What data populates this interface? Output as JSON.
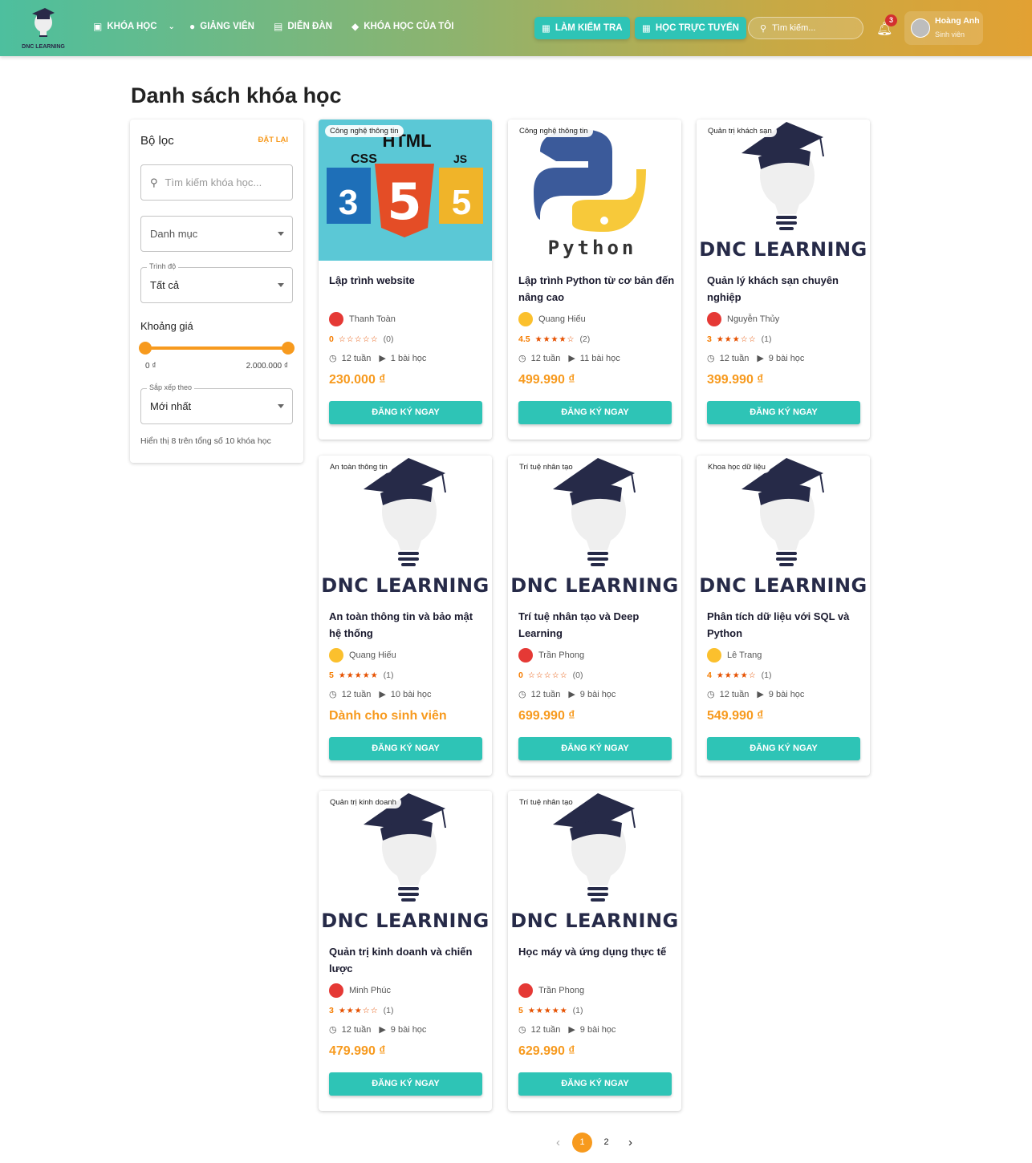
{
  "header": {
    "logo_text": "DNC LEARNING",
    "nav": [
      {
        "label": "KHÓA HỌC",
        "icon": "book-icon",
        "dropdown": true
      },
      {
        "label": "GIẢNG VIÊN",
        "icon": "person-icon"
      },
      {
        "label": "DIỄN ĐÀN",
        "icon": "forum-icon"
      },
      {
        "label": "KHÓA HỌC CỦA TÔI",
        "icon": "school-icon"
      }
    ],
    "quiz_button": "LÀM KIỂM TRA",
    "online_button": "HỌC TRỰC TUYẾN",
    "search_placeholder": "Tìm kiếm...",
    "notification_count": "3",
    "user_name": "Hoàng Anh",
    "user_role": "Sinh viên"
  },
  "page_title": "Danh sách khóa học",
  "filter": {
    "title": "Bộ lọc",
    "reset": "ĐẶT LẠI",
    "search_placeholder": "Tìm kiếm khóa học...",
    "category_placeholder": "Danh mục",
    "level_label": "Trình độ",
    "level_value": "Tất cả",
    "price_label": "Khoảng giá",
    "price_min": "0 ₫",
    "price_max": "2.000.000 ₫",
    "sort_label": "Sắp xếp theo",
    "sort_value": "Mới nhất",
    "summary": "Hiển thị 8 trên tổng số 10 khóa học"
  },
  "image_text": "DNC LEARNING",
  "courses": [
    {
      "category": "Công nghệ thông tin",
      "image": "html",
      "title": "Lập trình website",
      "author": "Thanh Toàn",
      "avatar_color": "#e53935",
      "rating": "0",
      "stars": "☆☆☆☆☆",
      "reviews": "(0)",
      "duration": "12 tuần",
      "lessons": "1 bài học",
      "price": "230.000 ₫"
    },
    {
      "category": "Công nghệ thông tin",
      "image": "python",
      "title": "Lập trình Python từ cơ bản đến nâng cao",
      "author": "Quang Hiếu",
      "avatar_color": "#fbc02d",
      "rating": "4.5",
      "stars": "★★★★☆",
      "reviews": "(2)",
      "duration": "12 tuần",
      "lessons": "11 bài học",
      "price": "499.990 ₫"
    },
    {
      "category": "Quản trị khách sạn",
      "image": "dnc",
      "title": "Quản lý khách sạn chuyên nghiệp",
      "author": "Nguyễn Thủy",
      "avatar_color": "#e53935",
      "rating": "3",
      "stars": "★★★☆☆",
      "reviews": "(1)",
      "duration": "12 tuần",
      "lessons": "9 bài học",
      "price": "399.990 ₫"
    },
    {
      "category": "An toàn thông tin",
      "image": "dnc",
      "title": "An toàn thông tin và bảo mật hệ thống",
      "author": "Quang Hiếu",
      "avatar_color": "#fbc02d",
      "rating": "5",
      "stars": "★★★★★",
      "reviews": "(1)",
      "duration": "12 tuần",
      "lessons": "10 bài học",
      "price": "Dành cho sinh viên"
    },
    {
      "category": "Trí tuệ nhân tạo",
      "image": "dnc",
      "title": "Trí tuệ nhân tạo và Deep Learning",
      "author": "Trần Phong",
      "avatar_color": "#e53935",
      "rating": "0",
      "stars": "☆☆☆☆☆",
      "reviews": "(0)",
      "duration": "12 tuần",
      "lessons": "9 bài học",
      "price": "699.990 ₫"
    },
    {
      "category": "Khoa học dữ liệu",
      "image": "dnc",
      "title": "Phân tích dữ liệu với SQL và Python",
      "author": "Lê Trang",
      "avatar_color": "#fbc02d",
      "rating": "4",
      "stars": "★★★★☆",
      "reviews": "(1)",
      "duration": "12 tuần",
      "lessons": "9 bài học",
      "price": "549.990 ₫"
    },
    {
      "category": "Quản trị kinh doanh",
      "image": "dnc",
      "title": "Quản trị kinh doanh và chiến lược",
      "author": "Minh Phúc",
      "avatar_color": "#e53935",
      "rating": "3",
      "stars": "★★★☆☆",
      "reviews": "(1)",
      "duration": "12 tuần",
      "lessons": "9 bài học",
      "price": "479.990 ₫"
    },
    {
      "category": "Trí tuệ nhân tạo",
      "image": "dnc",
      "title": "Học máy và ứng dụng thực tế",
      "author": "Trần Phong",
      "avatar_color": "#e53935",
      "rating": "5",
      "stars": "★★★★★",
      "reviews": "(1)",
      "duration": "12 tuần",
      "lessons": "9 bài học",
      "price": "629.990 ₫"
    }
  ],
  "register_label": "ĐĂNG KÝ NGAY",
  "pagination": {
    "prev": "‹",
    "pages": [
      "1",
      "2"
    ],
    "current": "1",
    "next": "›"
  },
  "colors": {
    "accent": "#f79a1e",
    "teal": "#2ec4b6",
    "navy": "#262a48"
  }
}
